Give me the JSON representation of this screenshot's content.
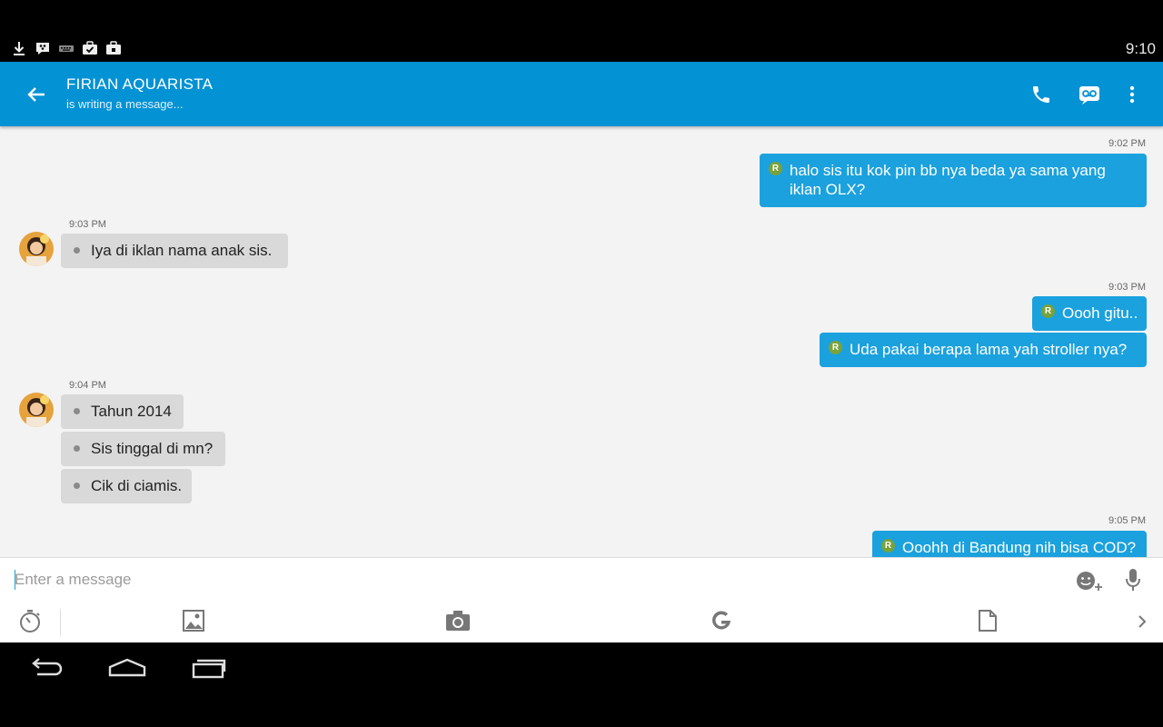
{
  "status_bar": {
    "time": "9:10",
    "icons": [
      "download-icon",
      "bbm-icon",
      "keyboard-icon",
      "briefcase-check-icon",
      "briefcase-lock-icon"
    ]
  },
  "app_bar": {
    "contact_name": "FIRIAN AQUARISTA",
    "contact_status": "is writing a message...",
    "actions": [
      "phone-icon",
      "voice-note-icon",
      "more-vert-icon"
    ]
  },
  "colors": {
    "app_bar": "#0392d4",
    "outgoing_bubble": "#1ba1dd",
    "incoming_bubble": "#d9d9d9",
    "read_badge": "#7aa23a"
  },
  "messages": [
    {
      "time": "9:02 PM"
    },
    {
      "text": "halo sis itu kok pin bb nya beda ya sama yang iklan OLX?",
      "line1": "halo sis itu kok pin bb nya beda ya sama yang",
      "line2": "iklan OLX?",
      "badge": "R"
    },
    {
      "time": "9:03 PM"
    },
    {
      "text": "Iya di iklan nama anak sis."
    },
    {
      "time": "9:03 PM"
    },
    {
      "text": "Oooh gitu..",
      "badge": "R"
    },
    {
      "text": "Uda pakai berapa lama yah stroller nya?",
      "badge": "R"
    },
    {
      "time": "9:04 PM"
    },
    {
      "text": "Tahun 2014"
    },
    {
      "text": "Sis tinggal di mn?"
    },
    {
      "text": "Cik di ciamis."
    },
    {
      "time": "9:05 PM"
    },
    {
      "text": "Ooohh di Bandung nih bisa COD?",
      "badge": "R"
    }
  ],
  "composer": {
    "placeholder": "Enter a message",
    "value": "",
    "toolbar": [
      "timer-icon",
      "image-icon",
      "camera-icon",
      "google-icon",
      "file-icon",
      "chevron-right-icon"
    ],
    "emoji_icon": "emoji-add-icon",
    "mic_icon": "mic-icon"
  },
  "nav_bar": [
    "back-icon",
    "home-icon",
    "recents-icon"
  ]
}
